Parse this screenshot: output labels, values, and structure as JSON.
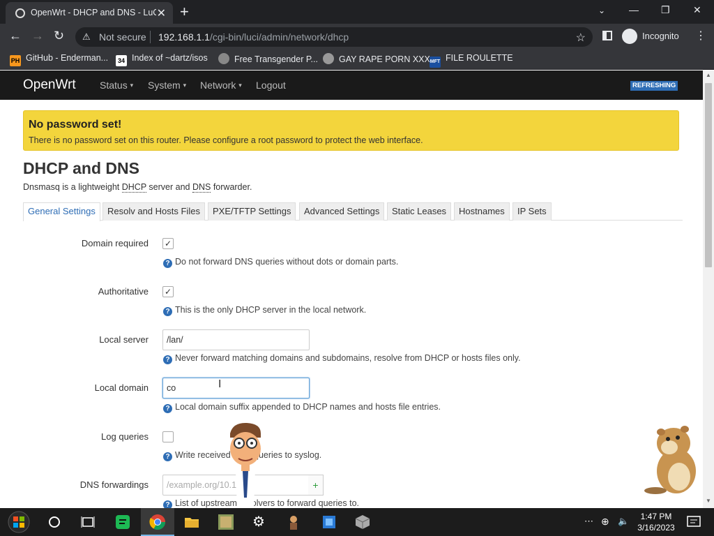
{
  "browser": {
    "tab_title": "OpenWrt - DHCP and DNS - LuCI",
    "tab_close": "✕",
    "new_tab": "+",
    "win_min": "—",
    "win_max": "❐",
    "win_close": "✕",
    "back": "←",
    "forward": "→",
    "reload": "↻",
    "not_secure": "Not secure",
    "url_host": "192.168.1.1",
    "url_path": "/cgi-bin/luci/admin/network/dhcp",
    "incognito": "Incognito",
    "menu": "⋮"
  },
  "bookmarks": [
    {
      "icon_text": "PH",
      "label": "GitHub - Enderman..."
    },
    {
      "icon_text": "34",
      "label": "Index of ~dartz/isos"
    },
    {
      "icon_text": "",
      "label": "Free Transgender P..."
    },
    {
      "icon_text": "",
      "label": "GAY RAPE PORN XXX"
    },
    {
      "icon_text": "MFT",
      "label": "FILE ROULETTE"
    }
  ],
  "luci": {
    "brand": "OpenWrt",
    "menu": [
      "Status",
      "System",
      "Network",
      "Logout"
    ],
    "badge": "REFRESHING",
    "alert_title": "No password set!",
    "alert_text": "There is no password set on this router. Please configure a root password to protect the web interface.",
    "page_title": "DHCP and DNS",
    "desc_pre": "Dnsmasq is a lightweight ",
    "desc_abbr1": "DHCP",
    "desc_mid": " server and ",
    "desc_abbr2": "DNS",
    "desc_post": " forwarder.",
    "tabs": [
      "General Settings",
      "Resolv and Hosts Files",
      "PXE/TFTP Settings",
      "Advanced Settings",
      "Static Leases",
      "Hostnames",
      "IP Sets"
    ],
    "fields": {
      "domain_required": {
        "label": "Domain required",
        "checked": true,
        "help": "Do not forward DNS queries without dots or domain parts."
      },
      "authoritative": {
        "label": "Authoritative",
        "checked": true,
        "help": "This is the only DHCP server in the local network."
      },
      "local_server": {
        "label": "Local server",
        "value": "/lan/",
        "help": "Never forward matching domains and subdomains, resolve from DHCP or hosts files only."
      },
      "local_domain": {
        "label": "Local domain",
        "value": "co",
        "help": "Local domain suffix appended to DHCP names and hosts file entries."
      },
      "log_queries": {
        "label": "Log queries",
        "checked": false,
        "help": "Write received DNS queries to syslog."
      },
      "dns_forwardings": {
        "label": "DNS forwardings",
        "placeholder": "/example.org/10.1.2.3",
        "help": "List of upstream resolvers to forward queries to."
      }
    },
    "check_glyph": "✓",
    "add_glyph": "+",
    "help_glyph": "?"
  },
  "taskbar": {
    "time": "1:47 PM",
    "date": "3/16/2023"
  }
}
